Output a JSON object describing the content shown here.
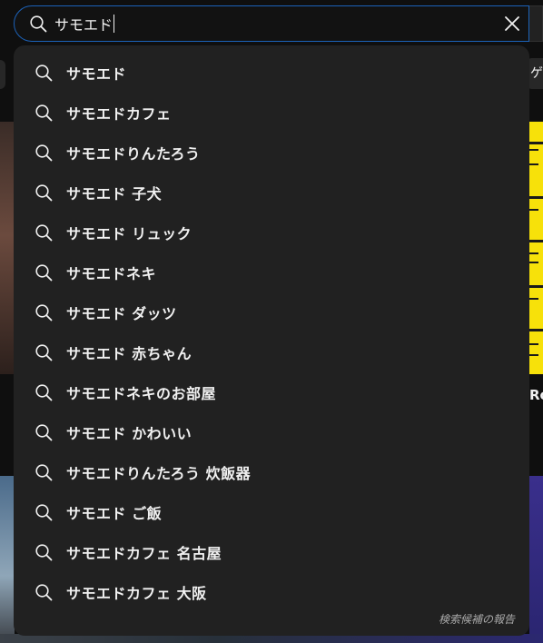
{
  "search": {
    "query": "サモエド",
    "clear_icon": "close-icon",
    "search_icon": "search-icon"
  },
  "background": {
    "chip_right_label": "ゲー",
    "video_title_right": "Ro"
  },
  "suggestions": [
    {
      "text": "サモエド",
      "icon": "search-icon"
    },
    {
      "text": "サモエドカフェ",
      "icon": "search-icon"
    },
    {
      "text": "サモエドりんたろう",
      "icon": "search-icon"
    },
    {
      "text": "サモエド 子犬",
      "icon": "search-icon"
    },
    {
      "text": "サモエド リュック",
      "icon": "search-icon"
    },
    {
      "text": "サモエドネキ",
      "icon": "search-icon"
    },
    {
      "text": "サモエド ダッツ",
      "icon": "search-icon"
    },
    {
      "text": "サモエド 赤ちゃん",
      "icon": "search-icon"
    },
    {
      "text": "サモエドネキのお部屋",
      "icon": "search-icon"
    },
    {
      "text": "サモエド かわいい",
      "icon": "search-icon"
    },
    {
      "text": "サモエドりんたろう 炊飯器",
      "icon": "search-icon"
    },
    {
      "text": "サモエド ご飯",
      "icon": "search-icon"
    },
    {
      "text": "サモエドカフェ 名古屋",
      "icon": "search-icon"
    },
    {
      "text": "サモエドカフェ 大阪",
      "icon": "search-icon"
    }
  ],
  "report_label": "検索候補の報告",
  "colors": {
    "page_bg": "#0f0f0f",
    "dropdown_bg": "#212121",
    "focus_border": "#1c62b9",
    "text": "#f1f1f1",
    "muted": "#aaaaaa"
  }
}
